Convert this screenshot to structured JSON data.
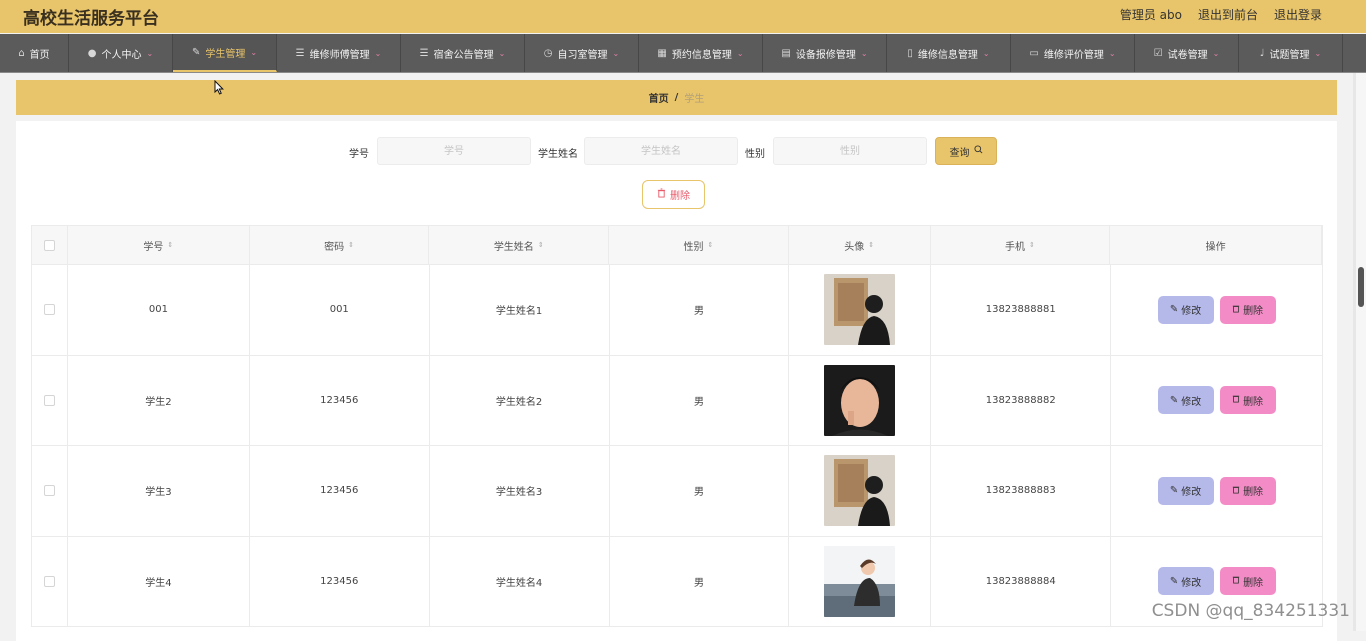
{
  "header": {
    "title": "高校生活服务平台",
    "links": [
      "管理员 abo",
      "退出到前台",
      "退出登录"
    ]
  },
  "nav": [
    {
      "label": "首页",
      "icon": "home-icon",
      "dropdown": false,
      "active": false
    },
    {
      "label": "个人中心",
      "icon": "user-icon",
      "dropdown": true,
      "active": false
    },
    {
      "label": "学生管理",
      "icon": "edit-icon",
      "dropdown": true,
      "active": true
    },
    {
      "label": "维修师傅管理",
      "icon": "list-icon",
      "dropdown": true,
      "active": false
    },
    {
      "label": "宿舍公告管理",
      "icon": "list-icon",
      "dropdown": true,
      "active": false
    },
    {
      "label": "自习室管理",
      "icon": "clock-icon",
      "dropdown": true,
      "active": false
    },
    {
      "label": "预约信息管理",
      "icon": "grid-icon",
      "dropdown": true,
      "active": false
    },
    {
      "label": "设备报修管理",
      "icon": "clipboard-icon",
      "dropdown": true,
      "active": false
    },
    {
      "label": "维修信息管理",
      "icon": "phone-icon",
      "dropdown": true,
      "active": false
    },
    {
      "label": "维修评价管理",
      "icon": "monitor-icon",
      "dropdown": true,
      "active": false
    },
    {
      "label": "试卷管理",
      "icon": "check-square-icon",
      "dropdown": true,
      "active": false
    },
    {
      "label": "试题管理",
      "icon": "mic-icon",
      "dropdown": true,
      "active": false
    }
  ],
  "breadcrumb": {
    "home": "首页",
    "separator": "/",
    "current": "学生"
  },
  "search": {
    "fields": [
      {
        "label": "学号",
        "placeholder": "学号"
      },
      {
        "label": "学生姓名",
        "placeholder": "学生姓名"
      },
      {
        "label": "性别",
        "placeholder": "性别"
      }
    ],
    "query_label": "查询"
  },
  "delete_label": "删除",
  "table": {
    "columns": [
      "学号",
      "密码",
      "学生姓名",
      "性别",
      "头像",
      "手机",
      "操作"
    ],
    "rows": [
      {
        "id": "001",
        "password": "001",
        "name": "学生姓名1",
        "gender": "男",
        "phone": "13823888881"
      },
      {
        "id": "学生2",
        "password": "123456",
        "name": "学生姓名2",
        "gender": "男",
        "phone": "13823888882"
      },
      {
        "id": "学生3",
        "password": "123456",
        "name": "学生姓名3",
        "gender": "男",
        "phone": "13823888883"
      },
      {
        "id": "学生4",
        "password": "123456",
        "name": "学生姓名4",
        "gender": "男",
        "phone": "13823888884"
      }
    ],
    "edit_label": "修改",
    "delete_label": "删除"
  },
  "watermark": "CSDN @qq_834251331",
  "colors": {
    "accent": "#e8c46a",
    "nav_bg": "#5b5b5b",
    "edit_btn": "#b5b9ea",
    "delete_btn": "#f38cc6"
  }
}
